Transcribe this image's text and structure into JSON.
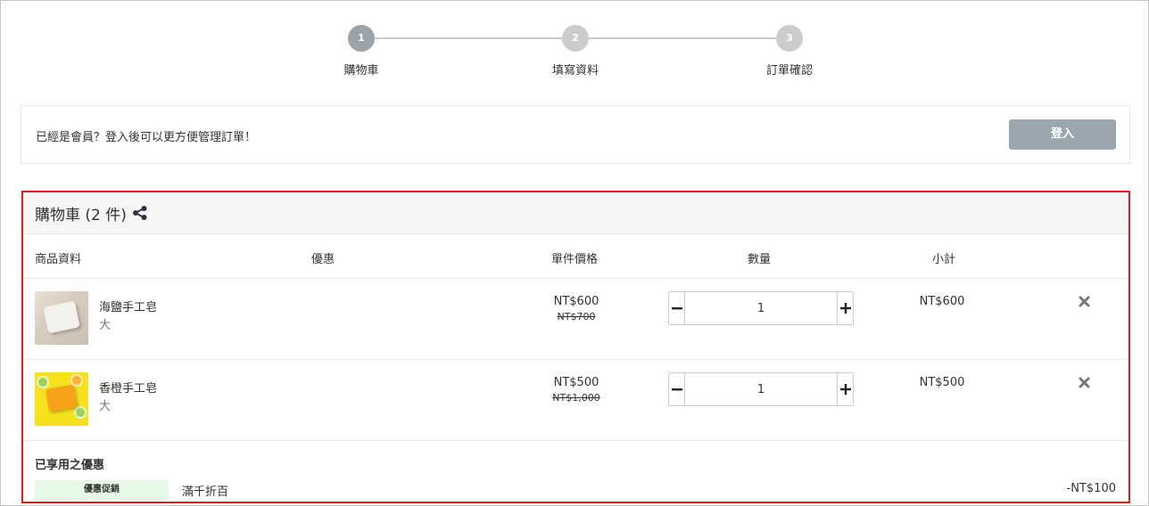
{
  "stepper": {
    "steps": [
      {
        "number": "1",
        "label": "購物車"
      },
      {
        "number": "2",
        "label": "填寫資料"
      },
      {
        "number": "3",
        "label": "訂單確認"
      }
    ]
  },
  "member": {
    "message": "已經是會員？登入後可以更方便管理訂單！",
    "login_label": "登入"
  },
  "cart": {
    "title": "購物車 (2 件)",
    "columns": {
      "product": "商品資料",
      "discount": "優惠",
      "unit_price": "單件價格",
      "quantity": "數量",
      "subtotal": "小計"
    },
    "items": [
      {
        "name": "海鹽手工皂",
        "variant": "大",
        "price": "NT$600",
        "original_price": "NT$700",
        "quantity": "1",
        "subtotal": "NT$600"
      },
      {
        "name": "香橙手工皂",
        "variant": "大",
        "price": "NT$500",
        "original_price": "NT$1,000",
        "quantity": "1",
        "subtotal": "NT$500"
      }
    ],
    "promotions": {
      "title": "已享用之優惠",
      "badge": "優惠促銷",
      "name": "滿千折百",
      "amount": "-NT$100"
    }
  },
  "colors": {
    "highlight_border": "#e31b1b",
    "login_button": "#9ba7ae",
    "step_active": "#9aa3aa",
    "step_inactive": "#cccccc",
    "promo_badge_bg": "#e6f9e6"
  },
  "icons": {
    "share": "share-icon",
    "minus": "minus-icon",
    "plus": "plus-icon",
    "remove": "close-icon"
  }
}
